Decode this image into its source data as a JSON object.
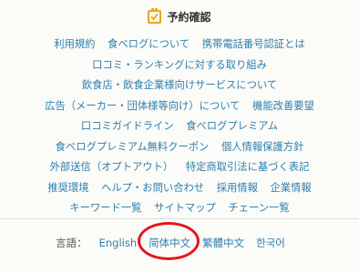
{
  "header": {
    "title": "予約確認",
    "icon": "calendar-check-icon"
  },
  "footer_links": [
    [
      "利用規約",
      "食べログについて",
      "携帯電話番号認証とは"
    ],
    [
      "口コミ・ランキングに対する取り組み"
    ],
    [
      "飲食店・飲食企業様向けサービスについて"
    ],
    [
      "広告（メーカー・団体様等向け）について",
      "機能改善要望"
    ],
    [
      "口コミガイドライン",
      "食べログプレミアム"
    ],
    [
      "食べログプレミアム無料クーポン",
      "個人情報保護方針"
    ],
    [
      "外部送信（オプトアウト）",
      "特定商取引法に基づく表記"
    ],
    [
      "推奨環境",
      "ヘルプ・お問い合わせ",
      "採用情報",
      "企業情報"
    ],
    [
      "キーワード一覧",
      "サイトマップ",
      "チェーン一覧"
    ]
  ],
  "language": {
    "label": "言語：",
    "options": [
      "English",
      "简体中文",
      "繁體中文",
      "한국어"
    ],
    "highlighted": "简体中文"
  },
  "colors": {
    "link": "#2f7fae",
    "accent": "#e8a629",
    "annotation": "#e3161f"
  }
}
